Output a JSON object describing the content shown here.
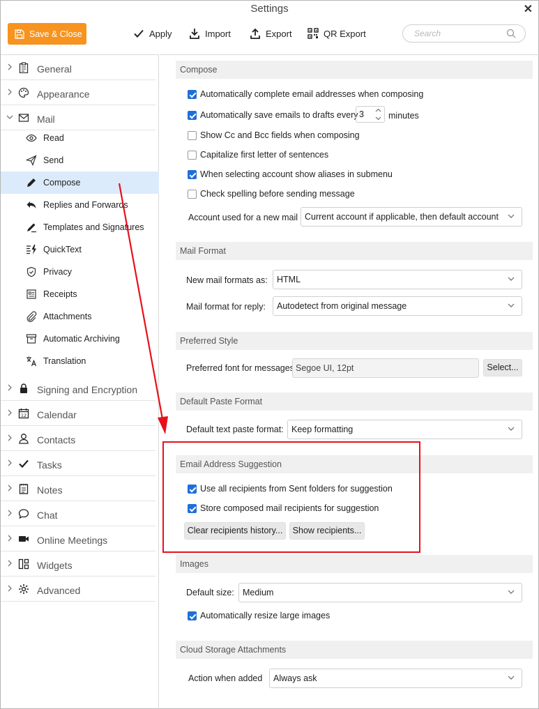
{
  "window": {
    "title": "Settings"
  },
  "toolbar": {
    "save_close": "Save & Close",
    "apply": "Apply",
    "import": "Import",
    "export": "Export",
    "qr_export": "QR Export",
    "search_placeholder": "Search"
  },
  "sidebar": {
    "top": [
      {
        "label": "General",
        "icon": "clipboard-icon"
      },
      {
        "label": "Appearance",
        "icon": "palette-icon"
      },
      {
        "label": "Mail",
        "icon": "envelope-icon"
      }
    ],
    "mail_sub": [
      {
        "label": "Read",
        "icon": "eye-icon"
      },
      {
        "label": "Send",
        "icon": "paper-plane-icon"
      },
      {
        "label": "Compose",
        "icon": "pencil-icon"
      },
      {
        "label": "Replies and Forwards",
        "icon": "reply-icon"
      },
      {
        "label": "Templates and Signatures",
        "icon": "signature-icon"
      },
      {
        "label": "QuickText",
        "icon": "quicktext-icon"
      },
      {
        "label": "Privacy",
        "icon": "shield-icon"
      },
      {
        "label": "Receipts",
        "icon": "receipt-icon"
      },
      {
        "label": "Attachments",
        "icon": "paperclip-icon"
      },
      {
        "label": "Automatic Archiving",
        "icon": "archive-icon"
      },
      {
        "label": "Translation",
        "icon": "translate-icon"
      }
    ],
    "bottom": [
      {
        "label": "Signing and Encryption",
        "icon": "lock-icon"
      },
      {
        "label": "Calendar",
        "icon": "calendar-icon"
      },
      {
        "label": "Contacts",
        "icon": "person-icon"
      },
      {
        "label": "Tasks",
        "icon": "checkmark-icon"
      },
      {
        "label": "Notes",
        "icon": "notes-icon"
      },
      {
        "label": "Chat",
        "icon": "chat-bubble-icon"
      },
      {
        "label": "Online Meetings",
        "icon": "video-camera-icon"
      },
      {
        "label": "Widgets",
        "icon": "widgets-icon"
      },
      {
        "label": "Advanced",
        "icon": "gear-icon"
      }
    ]
  },
  "compose": {
    "header": "Compose",
    "auto_complete": "Automatically complete email addresses when composing",
    "auto_save": "Automatically save emails to drafts every",
    "auto_save_value": "3",
    "minutes": "minutes",
    "show_cc_bcc": "Show Cc and Bcc fields when composing",
    "capitalize": "Capitalize first letter of sentences",
    "aliases": "When selecting account show aliases in submenu",
    "spelling": "Check spelling before sending message",
    "account_label": "Account used for a new mail",
    "account_value": "Current account if applicable, then default account"
  },
  "mail_format": {
    "header": "Mail Format",
    "new_label": "New mail formats as:",
    "new_value": "HTML",
    "reply_label": "Mail format for reply:",
    "reply_value": "Autodetect from original message"
  },
  "preferred_style": {
    "header": "Preferred Style",
    "font_label": "Preferred font for messages:",
    "font_value": "Segoe UI, 12pt",
    "select_btn": "Select..."
  },
  "paste_format": {
    "header": "Default Paste Format",
    "label": "Default text paste format:",
    "value": "Keep formatting"
  },
  "suggestion": {
    "header": "Email Address Suggestion",
    "use_sent": "Use all recipients from Sent folders for suggestion",
    "store_composed": "Store composed mail recipients for suggestion",
    "clear_btn": "Clear recipients history...",
    "show_btn": "Show recipients..."
  },
  "images": {
    "header": "Images",
    "size_label": "Default size:",
    "size_value": "Medium",
    "resize": "Automatically resize large images"
  },
  "cloud": {
    "header": "Cloud Storage Attachments",
    "action_label": "Action when added",
    "action_value": "Always ask"
  },
  "colors": {
    "accent_orange": "#f7931e",
    "checkbox_blue": "#1e6fd9",
    "selection": "#dcebfb",
    "highlight_red": "#e8101b"
  }
}
